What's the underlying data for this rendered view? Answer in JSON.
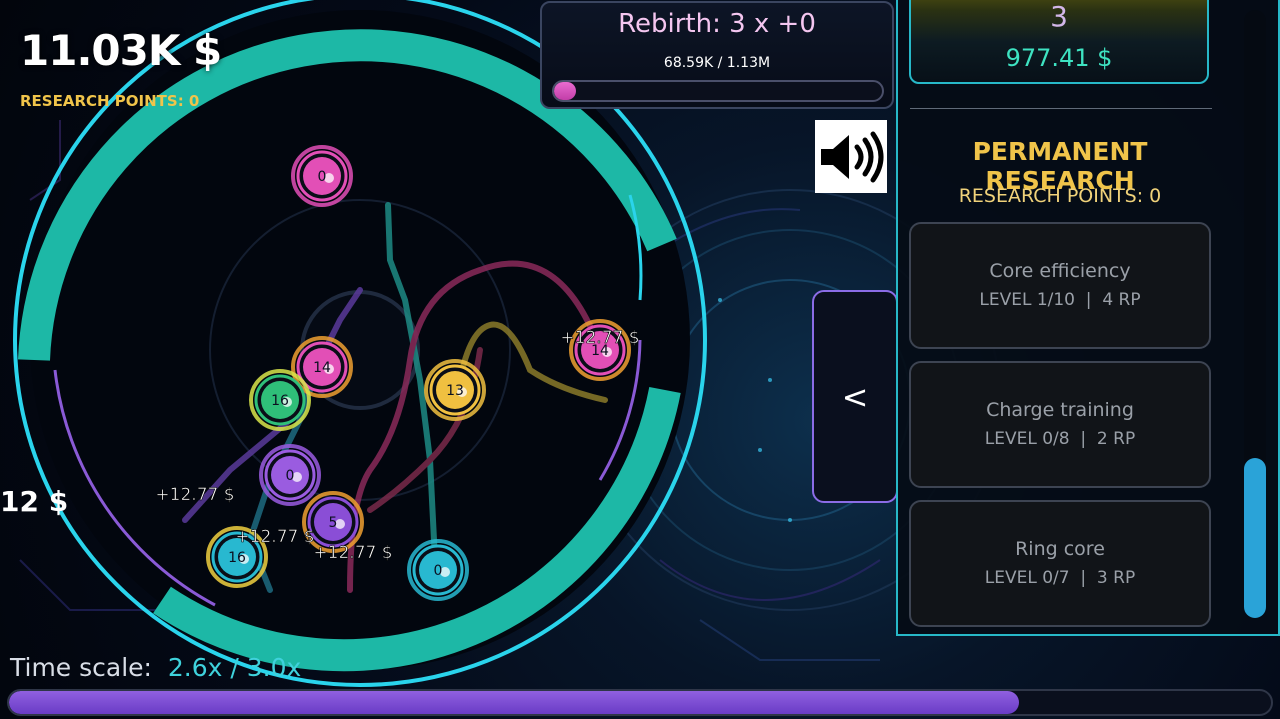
{
  "hud": {
    "money": "11.03K $",
    "research_points": "RESEARCH POINTS: 0",
    "cut_off_money": "12 $"
  },
  "rebirth": {
    "title": "Rebirth: 3 x  +0",
    "progress_text": "68.59K / 1.13M",
    "progress_fraction": 0.068
  },
  "sound": {
    "icon": "speaker-icon"
  },
  "collapse_button": {
    "label": "<"
  },
  "panel": {
    "top_card": {
      "number": "3",
      "money": "977.41 $"
    },
    "heading": "PERMANENT RESEARCH",
    "research_points": "RESEARCH POINTS: 0",
    "cards": [
      {
        "title": "Core efficiency",
        "level": "LEVEL 1/10  |  4 RP"
      },
      {
        "title": "Charge training",
        "level": "LEVEL 0/8  |  2 RP"
      },
      {
        "title": "Ring core",
        "level": "LEVEL 0/7  |  3 RP"
      }
    ]
  },
  "time_scale": {
    "label": "Time scale:",
    "value": "2.6x / 3.0x",
    "fraction": 0.8
  },
  "arena": {
    "balls": [
      {
        "label": "0",
        "color": "#e24fb6",
        "ring": "#e24fb6"
      },
      {
        "label": "14",
        "color": "#e24fb6",
        "ring": "#f0a030"
      },
      {
        "label": "16",
        "color": "#2fbf79",
        "ring": "#d9e64a"
      },
      {
        "label": "13",
        "color": "#f0c040",
        "ring": "#f0c040"
      },
      {
        "label": "14",
        "color": "#e24fb6",
        "ring": "#f0a030"
      },
      {
        "label": "0",
        "color": "#9a5ce0",
        "ring": "#9a5ce0"
      },
      {
        "label": "5",
        "color": "#8a4ed6",
        "ring": "#f0a030"
      },
      {
        "label": "16",
        "color": "#28b8d0",
        "ring": "#f0d040"
      },
      {
        "label": "0",
        "color": "#28b8d0",
        "ring": "#28b8d0"
      }
    ],
    "popups": [
      "+12.77 $",
      "+12.77 $",
      "+12.77 $",
      "+12.77 $"
    ],
    "colors": {
      "outer_ring": "#1db8a6",
      "rim": "#2ad4ec",
      "inner_rim": "#8a5ad6"
    }
  }
}
